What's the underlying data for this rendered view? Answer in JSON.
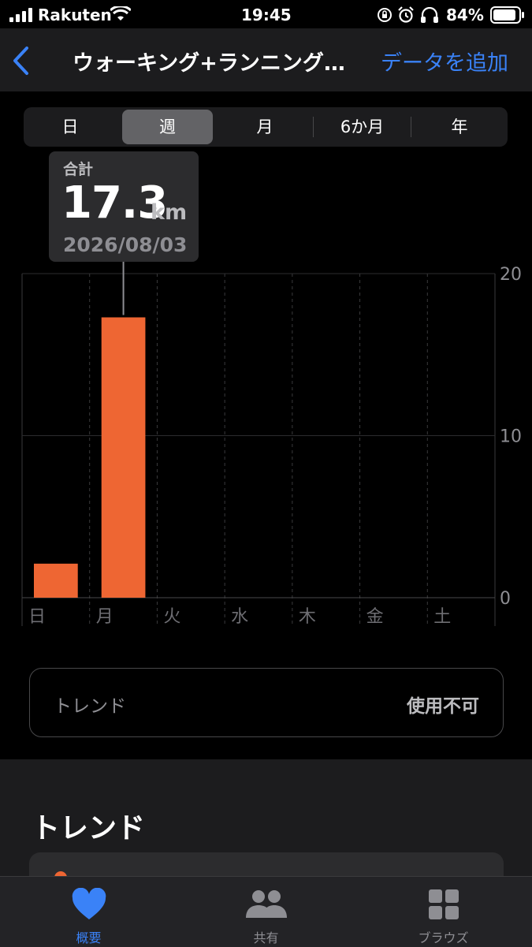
{
  "status": {
    "carrier": "Rakuten",
    "time": "19:45",
    "battery": "84%"
  },
  "nav": {
    "back_icon": "chevron-left-icon",
    "title": "ウォーキング+ランニング…",
    "add_label": "データを追加"
  },
  "segments": [
    {
      "label": "日",
      "active": false
    },
    {
      "label": "週",
      "active": true
    },
    {
      "label": "月",
      "active": false
    },
    {
      "label": "6か月",
      "active": false
    },
    {
      "label": "年",
      "active": false
    }
  ],
  "tooltip": {
    "label": "合計",
    "value": "17.3",
    "unit": "km",
    "date": "2026/08/03"
  },
  "chart_data": {
    "type": "bar",
    "categories": [
      "日",
      "月",
      "火",
      "水",
      "木",
      "金",
      "土"
    ],
    "values": [
      2.1,
      17.3,
      0,
      0,
      0,
      0,
      0
    ],
    "ylim": [
      0,
      20
    ],
    "yticks": [
      "0",
      "10",
      "20"
    ],
    "color": "#ee6633",
    "grid": true,
    "highlight_index": 1
  },
  "trend_box": {
    "label": "トレンド",
    "value": "使用不可"
  },
  "trends_section": {
    "heading": "トレンド"
  },
  "tabbar": [
    {
      "label": "概要",
      "icon": "heart-icon",
      "active": true
    },
    {
      "label": "共有",
      "icon": "people-icon",
      "active": false
    },
    {
      "label": "ブラウズ",
      "icon": "grid-icon",
      "active": false
    }
  ]
}
